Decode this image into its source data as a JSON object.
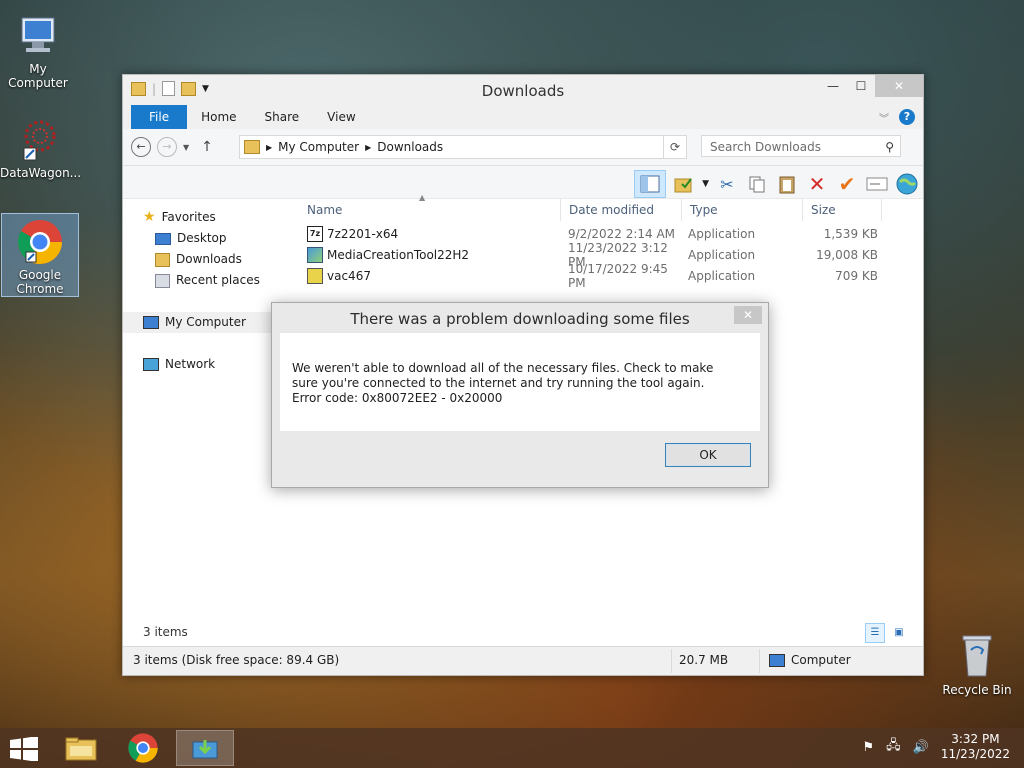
{
  "desktop": {
    "icons": [
      {
        "label": "My Computer"
      },
      {
        "label": "DataWagon..."
      },
      {
        "label": "Google Chrome"
      }
    ],
    "recycle_bin": "Recycle Bin"
  },
  "window": {
    "title": "Downloads",
    "ribbon_tabs": [
      "File",
      "Home",
      "Share",
      "View"
    ],
    "address": {
      "segments": [
        "My Computer",
        "Downloads"
      ]
    },
    "search_placeholder": "Search Downloads",
    "navpane": {
      "favorites": "Favorites",
      "favorites_items": [
        "Desktop",
        "Downloads",
        "Recent places"
      ],
      "my_computer": "My Computer",
      "network": "Network"
    },
    "columns": {
      "name": "Name",
      "date": "Date modified",
      "type": "Type",
      "size": "Size"
    },
    "files": [
      {
        "name": "7z2201-x64",
        "date": "9/2/2022 2:14 AM",
        "type": "Application",
        "size": "1,539 KB"
      },
      {
        "name": "MediaCreationTool22H2",
        "date": "11/23/2022 3:12 PM",
        "type": "Application",
        "size": "19,008 KB"
      },
      {
        "name": "vac467",
        "date": "10/17/2022 9:45 PM",
        "type": "Application",
        "size": "709 KB"
      }
    ],
    "items_count": "3 items",
    "status": {
      "left": "3 items (Disk free space: 89.4 GB)",
      "size": "20.7 MB",
      "location": "Computer"
    }
  },
  "dialog": {
    "title": "There was a problem downloading some files",
    "message": "We weren't able to download all of the necessary files. Check to make sure you're connected to the internet and try running the tool again. Error code: 0x80072EE2 - 0x20000",
    "ok_label": "OK"
  },
  "taskbar": {
    "time": "3:32 PM",
    "date": "11/23/2022"
  },
  "colors": {
    "accent": "#1979ca",
    "close_button": "#c7c7c7",
    "taskbar": "#503422"
  }
}
